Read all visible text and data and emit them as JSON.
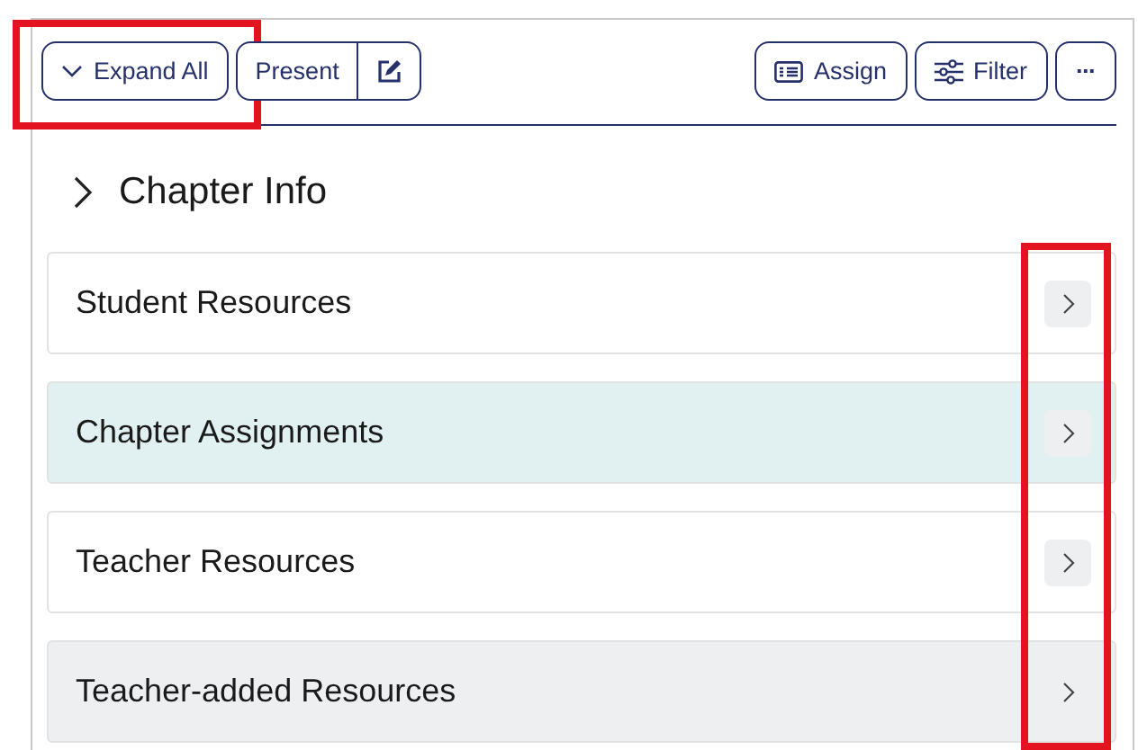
{
  "toolbar": {
    "expand_all_highlighted": true,
    "left_buttons": [
      {
        "kind": "expand",
        "label": "Expand All"
      },
      {
        "kind": "text",
        "label": "Present"
      },
      {
        "kind": "edit"
      }
    ],
    "right_buttons": [
      {
        "kind": "assign",
        "label": "Assign"
      },
      {
        "kind": "filter",
        "label": "Filter"
      },
      {
        "kind": "more",
        "label": "···"
      }
    ]
  },
  "section": {
    "title": "Chapter Info",
    "expanded": false
  },
  "rows_arrows_highlighted": true,
  "rows": [
    {
      "label": "Student Resources",
      "color": "#ffffff"
    },
    {
      "label": "Chapter Assignments",
      "color": "#e1f1f1"
    },
    {
      "label": "Teacher Resources",
      "color": "#ffffff"
    },
    {
      "label": "Teacher-added Resources",
      "color": "#eeeff1"
    }
  ]
}
